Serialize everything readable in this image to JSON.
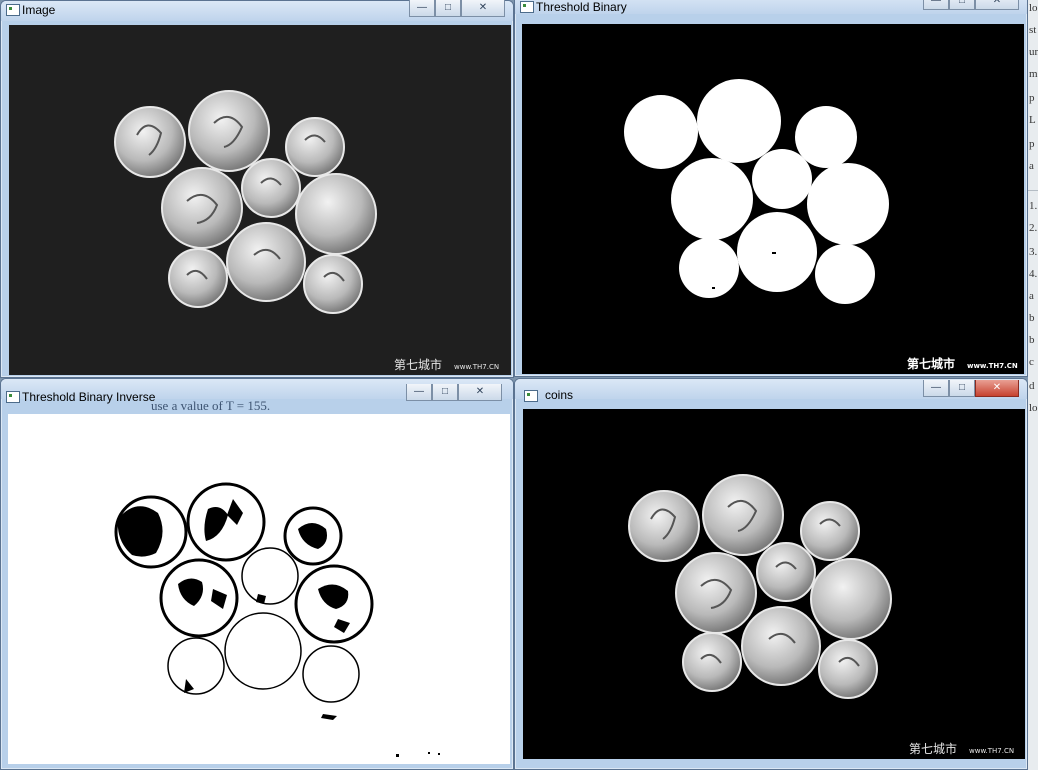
{
  "windows": {
    "image": {
      "title": "Image"
    },
    "binary": {
      "title": "Threshold Binary"
    },
    "inverse": {
      "title": "Threshold Binary Inverse"
    },
    "coins": {
      "title": "coins"
    }
  },
  "watermark": {
    "cn": "第七城市",
    "url": "www.TH7.CN"
  },
  "ghost_text": {
    "line": "use a value of T = 155."
  },
  "controls": {
    "minimize": "—",
    "maximize": "□",
    "close": "✕"
  },
  "side_glyphs": [
    "lo",
    "st",
    "un",
    "m",
    "p",
    "L",
    "p",
    "a",
    "1.",
    "2.",
    "3.",
    "4.",
    "a",
    "b",
    "b",
    "c",
    "d",
    "lo"
  ]
}
